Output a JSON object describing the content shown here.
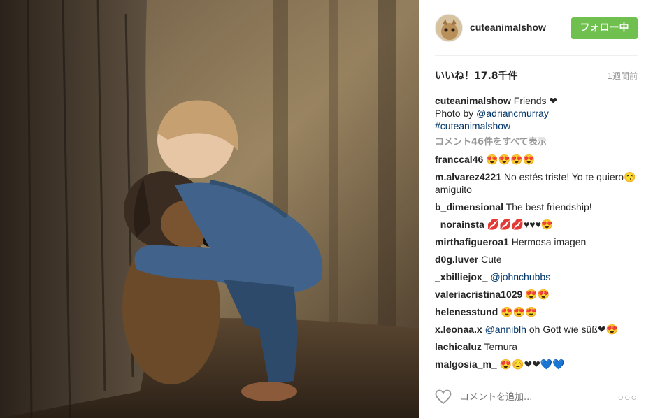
{
  "post": {
    "image_alt": "child hugging a dog by a tree",
    "username": "cuteanimalshow",
    "follow_label": "フォロー中",
    "likes_label": "いいね！17.8千件",
    "time_ago": "1週間前",
    "caption": {
      "author": "cuteanimalshow",
      "text": " Friends ❤",
      "photo_by_prefix": "Photo by ",
      "photo_by_link": "@adriancmurray",
      "hashtag": "#cuteanimalshow"
    },
    "view_all_comments": "コメント46件をすべて表示",
    "comments": [
      {
        "author": "franccal46",
        "text": " 😍😍😍😍",
        "mention": ""
      },
      {
        "author": "m.alvarez4221",
        "text": " No estés triste! Yo te quiero😙amiguito",
        "mention": ""
      },
      {
        "author": "b_dimensional",
        "text": " The best friendship!",
        "mention": ""
      },
      {
        "author": "_norainsta",
        "text": " 💋💋💋♥♥♥😍",
        "mention": ""
      },
      {
        "author": "mirthafigueroa1",
        "text": " Hermosa imagen",
        "mention": ""
      },
      {
        "author": "d0g.luver",
        "text": " Cute",
        "mention": ""
      },
      {
        "author": "_xbilliejox_",
        "text": "",
        "mention": " @johnchubbs"
      },
      {
        "author": "valeriacristina1029",
        "text": " 😍😍",
        "mention": ""
      },
      {
        "author": "helenesstund",
        "text": " 😍😍😍",
        "mention": ""
      },
      {
        "author": "x.leonaa.x",
        "text": " oh Gott wie süß❤😍",
        "mention": " @anniblh"
      },
      {
        "author": "lachicaluz",
        "text": " Ternura",
        "mention": ""
      },
      {
        "author": "malgosia_m_",
        "text": " 😍😊❤❤💙💙",
        "mention": ""
      }
    ],
    "add_comment_placeholder": "コメントを追加...",
    "more_label": "○○○"
  },
  "colors": {
    "follow_button": "#70c050",
    "link": "#003569",
    "muted": "#999999"
  },
  "icons": {
    "like": "heart-outline-icon",
    "more": "ellipsis-icon"
  }
}
